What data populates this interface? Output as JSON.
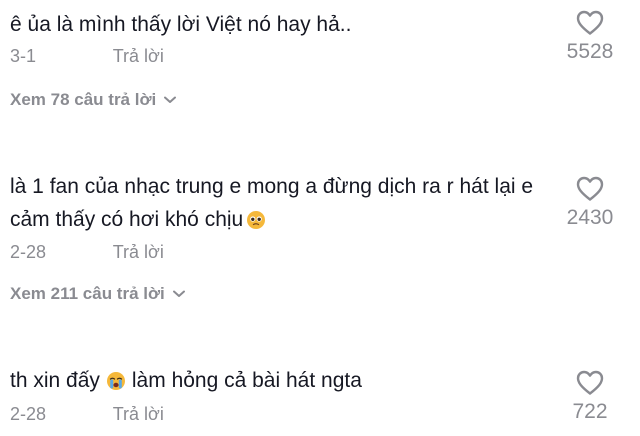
{
  "comments": [
    {
      "text": "ê ủa là mình thấy lời Việt nó hay hả..",
      "date": "3-1",
      "reply_label": "Trả lời",
      "likes": "5528",
      "view_replies": "Xem 78 câu trả lời"
    },
    {
      "text": "là 1 fan của nhạc trung e mong a đừng dịch ra r hát lại e cảm thấy có hơi khó chịu",
      "emoji": "pleading-face-emoji",
      "date": "2-28",
      "reply_label": "Trả lời",
      "likes": "2430",
      "view_replies": "Xem 211 câu trả lời"
    },
    {
      "text_before": "th xin đấy",
      "emoji": "crying-face-emoji",
      "text_after": "làm hỏng cả bài hát ngta",
      "date": "2-28",
      "reply_label": "Trả lời",
      "likes": "722"
    }
  ],
  "icons": {
    "like": "heart-outline-icon",
    "expand": "chevron-down-icon"
  },
  "colors": {
    "text": "#161823",
    "muted": "#8a8b91",
    "emoji": "#f5b83a"
  }
}
